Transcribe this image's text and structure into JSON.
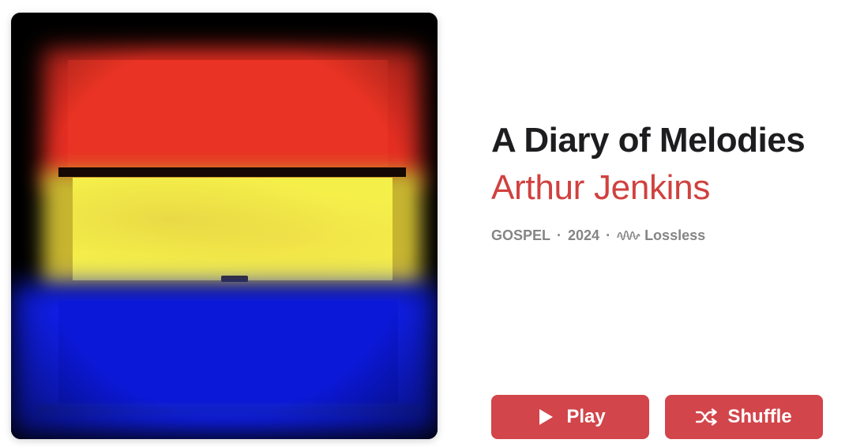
{
  "album": {
    "title": "A Diary of Melodies",
    "artist": "Arthur Jenkins",
    "genre": "GOSPEL",
    "year": "2024",
    "separator": "·",
    "quality": "Lossless",
    "quality_icon": "lossless-waveform-icon",
    "artwork_icon": "album-artwork"
  },
  "actions": {
    "play_label": "Play",
    "play_icon": "play-icon",
    "shuffle_label": "Shuffle",
    "shuffle_icon": "shuffle-icon"
  },
  "colors": {
    "accent": "#d2454a",
    "artist_text": "#d0413f",
    "title_text": "#1d1d1f",
    "meta_text": "#858585"
  }
}
